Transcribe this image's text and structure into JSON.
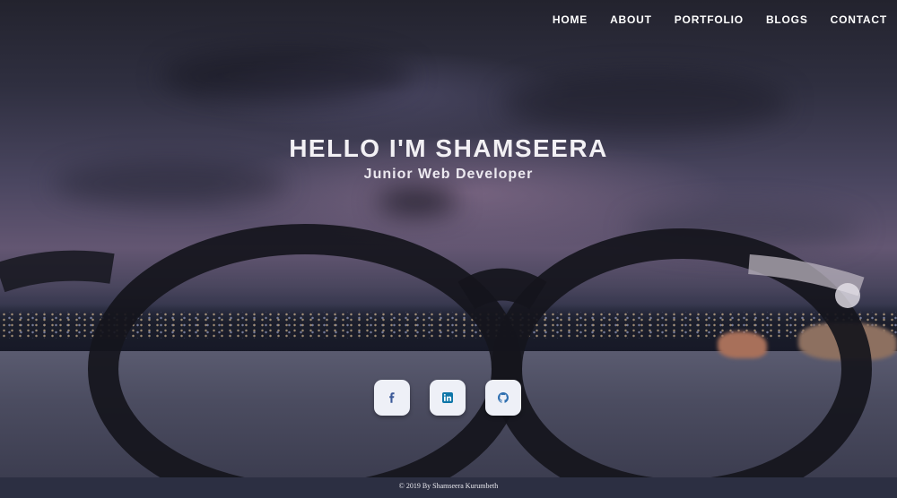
{
  "nav": {
    "items": [
      {
        "label": "HOME"
      },
      {
        "label": "ABOUT"
      },
      {
        "label": "PORTFOLIO"
      },
      {
        "label": "BLOGS"
      },
      {
        "label": "CONTACT"
      }
    ]
  },
  "intro": {
    "title": "HELLO I'M SHAMSEERA",
    "subtitle": "Junior Web Developer"
  },
  "socials": [
    {
      "icon": "facebook-icon",
      "color": "#3b5998"
    },
    {
      "icon": "linkedin-icon",
      "color": "#0e76a8"
    },
    {
      "icon": "github-icon",
      "color": "#2f6fb0"
    }
  ],
  "footer": {
    "text": "© 2019 By Shamseera Kurumbeth"
  }
}
